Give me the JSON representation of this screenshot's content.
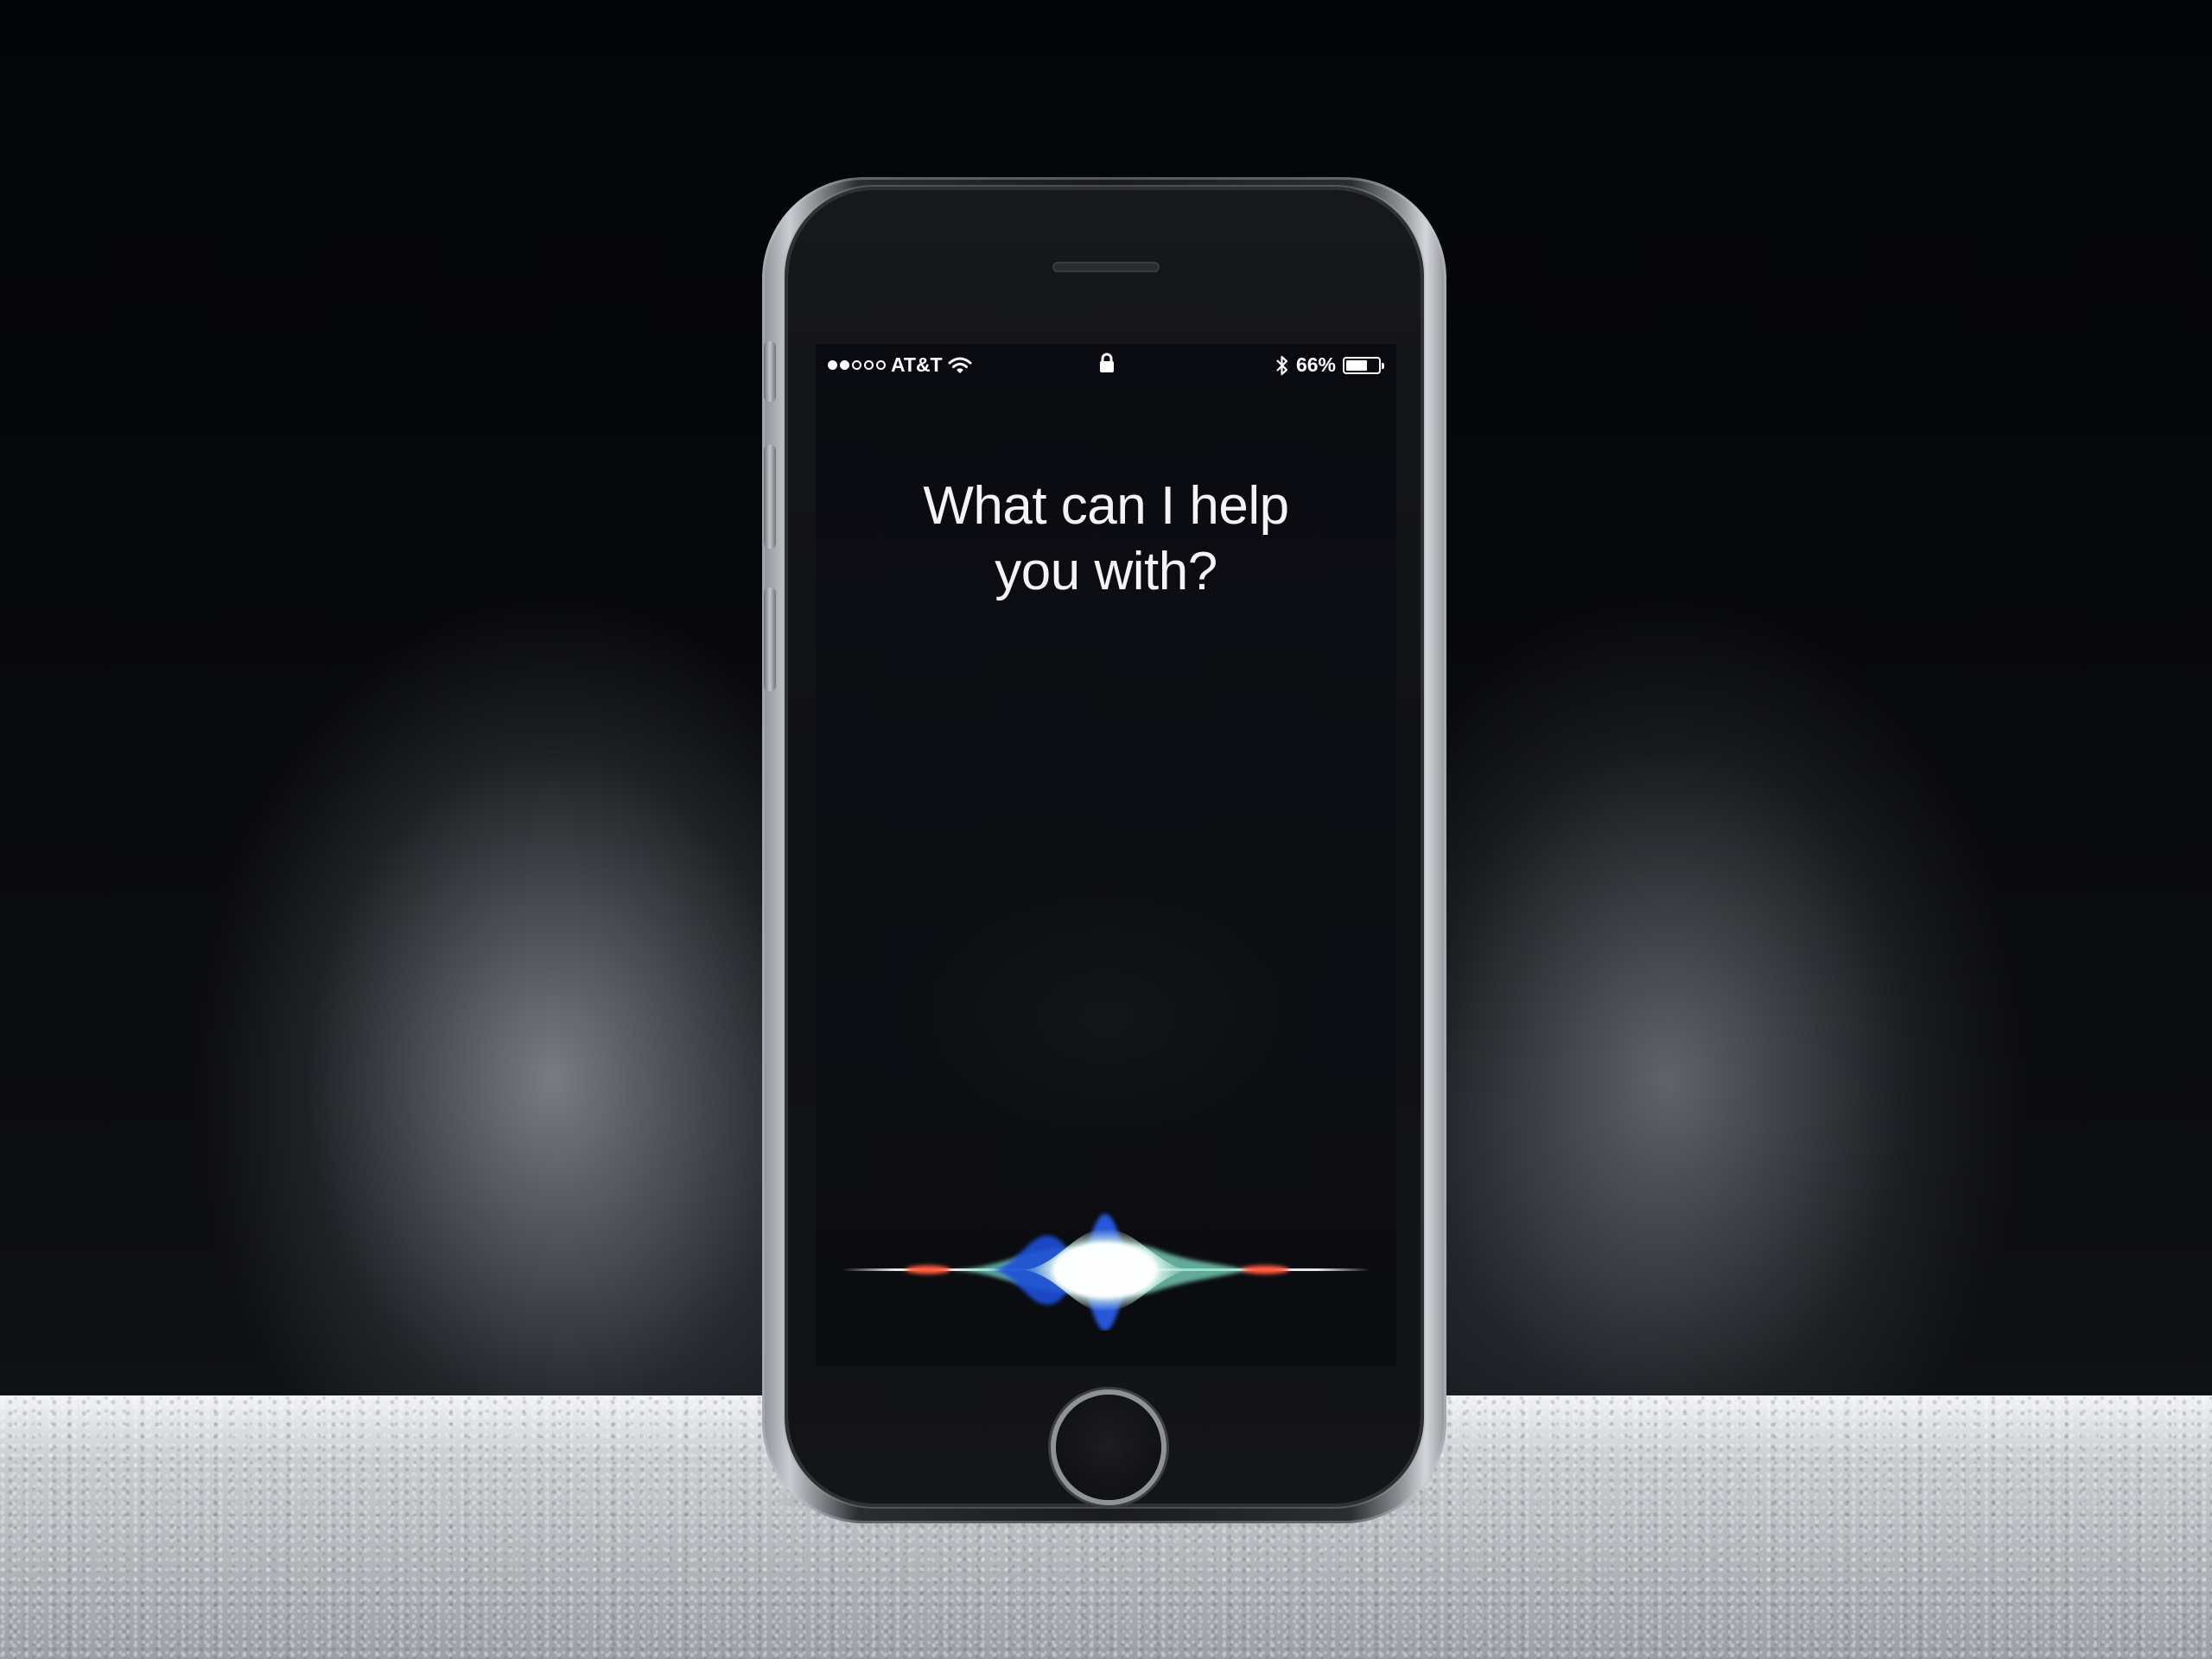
{
  "status_bar": {
    "carrier": "AT&T",
    "signal_bars_filled": 2,
    "signal_bars_total": 5,
    "battery_percent": "66%",
    "battery_level": 0.66,
    "icons": [
      "signal-dots-icon",
      "wifi-icon",
      "lock-icon",
      "bluetooth-icon",
      "battery-icon"
    ]
  },
  "siri": {
    "prompt_line1": "What can I help",
    "prompt_line2": "you with?"
  },
  "colors": {
    "text": "#ffffff",
    "wave_blue": "#1f4fd8",
    "wave_light": "#d9f7ef",
    "wave_teal": "#7fe0c8",
    "wave_red": "#ff5a3c"
  }
}
